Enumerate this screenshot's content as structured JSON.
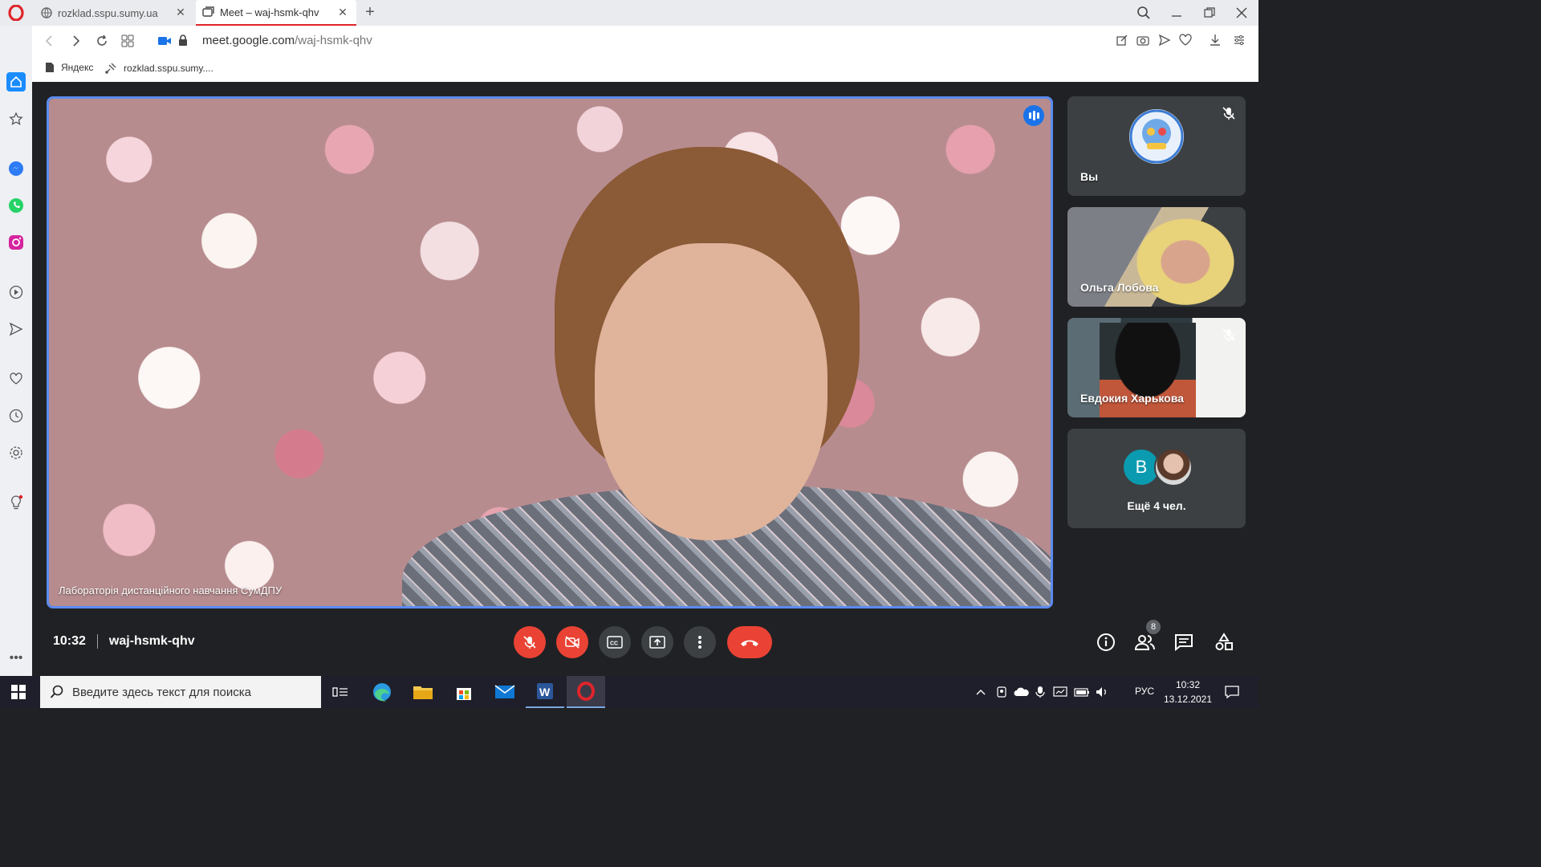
{
  "browser": {
    "tabs": [
      {
        "title": "rozklad.sspu.sumy.ua"
      },
      {
        "title": "Meet – waj-hsmk-qhv"
      }
    ],
    "url_host": "meet.google.com",
    "url_path": "/waj-hsmk-qhv",
    "bookmarks": [
      {
        "label": "Яндекс"
      },
      {
        "label": "rozklad.sspu.sumy...."
      }
    ]
  },
  "meet": {
    "main_speaker_name": "Лабораторія дистанційного навчання СумДПУ",
    "tiles": [
      {
        "name": "Вы",
        "muted": true
      },
      {
        "name": "Ольга Лобова",
        "muted": false
      },
      {
        "name": "Евдокия Харькова",
        "muted": true
      }
    ],
    "more": {
      "label": "Ещё 4 чел.",
      "avatar_letter": "В"
    },
    "time": "10:32",
    "meeting_code": "waj-hsmk-qhv",
    "participant_count": "8"
  },
  "taskbar": {
    "search_placeholder": "Введите здесь текст для поиска",
    "language": "РУС",
    "time": "10:32",
    "date": "13.12.2021"
  },
  "colors": {
    "accent_blue": "#1a73e8",
    "hangup_red": "#ea4335",
    "meet_bg": "#202124",
    "tile_bg": "#3c4043",
    "opera_red": "#e0242b"
  }
}
